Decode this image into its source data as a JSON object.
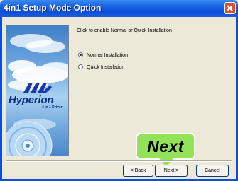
{
  "window": {
    "title": "4in1 Setup Mode Option"
  },
  "content": {
    "instruction": "Click to enable Normal or Quick Installation",
    "options": [
      {
        "label": "Normal Installation",
        "selected": true
      },
      {
        "label": "Quick Installation",
        "selected": false
      }
    ]
  },
  "logo": {
    "brand": "VIA",
    "name": "Hyperion",
    "subtitle": "4 in 1 Driver"
  },
  "callout": {
    "text": "Next",
    "color": "#93e35a"
  },
  "buttons": {
    "back": "< Back",
    "next": "Next >",
    "cancel": "Cancel"
  },
  "colors": {
    "titlebar": "#0a4fd8",
    "close": "#d74f2c",
    "frame": "#0b4fd6",
    "dialog_bg": "#ece9d8"
  }
}
